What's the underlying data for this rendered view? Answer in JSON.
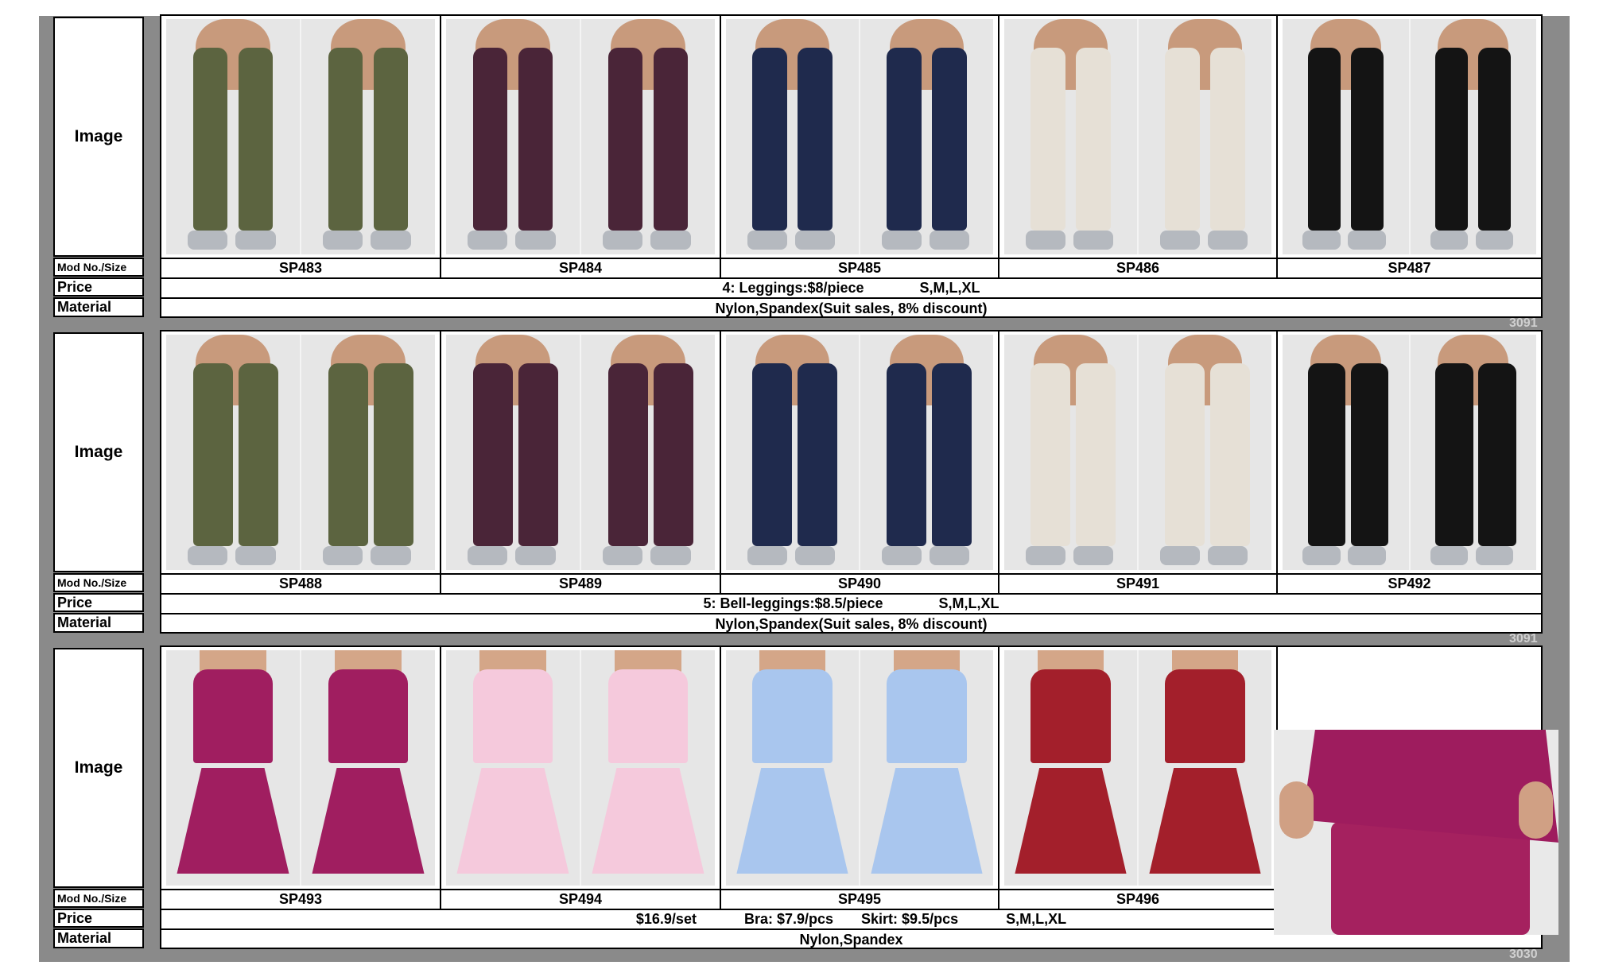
{
  "labels": {
    "image": "Image",
    "mod": "Mod No./Size",
    "price": "Price",
    "material": "Material"
  },
  "sections": [
    {
      "models": [
        "SP483",
        "SP484",
        "SP485",
        "SP486",
        "SP487"
      ],
      "price": "4: Leggings:$8/piece              S,M,L,XL",
      "material": "Nylon,Spandex(Suit sales, 8% discount)",
      "watermark": "3091",
      "colors": [
        "#5c6440",
        "#4a2538",
        "#1f2a4d",
        "#e6e0d6",
        "#141414"
      ]
    },
    {
      "models": [
        "SP488",
        "SP489",
        "SP490",
        "SP491",
        "SP492"
      ],
      "price": "5: Bell-leggings:$8.5/piece              S,M,L,XL",
      "material": "Nylon,Spandex(Suit sales, 8% discount)",
      "watermark": "3091",
      "colors": [
        "#5c6440",
        "#4a2538",
        "#1f2a4d",
        "#e6e0d6",
        "#141414"
      ]
    },
    {
      "models": [
        "SP493",
        "SP494",
        "SP495",
        "SP496",
        ""
      ],
      "price": "$16.9/set            Bra: $7.9/pcs       Skirt: $9.5/pcs            S,M,L,XL",
      "material": "Nylon,Spandex",
      "watermark": "3030",
      "colors": [
        "#a01e60",
        "#f5c9dc",
        "#a9c6ee",
        "#a31f2b",
        ""
      ]
    }
  ]
}
